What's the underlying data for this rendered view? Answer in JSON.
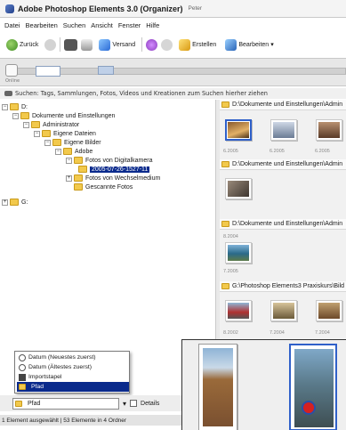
{
  "window": {
    "title": "Adobe Photoshop Elements 3.0 (Organizer)",
    "user": "Peter"
  },
  "menu": [
    "Datei",
    "Bearbeiten",
    "Suchen",
    "Ansicht",
    "Fenster",
    "Hilfe"
  ],
  "toolbar": {
    "back": "Zurück",
    "send": "Versand",
    "create": "Erstellen",
    "edit": "Bearbeiten"
  },
  "timeline": {
    "label": "Online"
  },
  "search": {
    "hint": "Suchen: Tags, Sammlungen, Fotos, Videos und Kreationen zum Suchen hierher ziehen"
  },
  "tree": [
    {
      "label": "D:"
    },
    {
      "label": "Dokumente und Einstellungen"
    },
    {
      "label": "Administrator"
    },
    {
      "label": "Eigene Dateien"
    },
    {
      "label": "Eigene Bilder"
    },
    {
      "label": "Adobe"
    },
    {
      "label": "Fotos von Digitalkamera"
    },
    {
      "label": "2005-07-26-1527-11"
    },
    {
      "label": "Fotos von Wechselmedium"
    },
    {
      "label": "Gescannte Fotos"
    },
    {
      "label": "G:"
    }
  ],
  "groups": [
    {
      "path": "D:\\Dokumente und Einstellungen\\Admin",
      "dates": [
        "6.2005",
        "6.2005",
        "6.2005"
      ]
    },
    {
      "path": "D:\\Dokumente und Einstellungen\\Admin",
      "dates": [
        "8.2004"
      ]
    },
    {
      "path": "D:\\Dokumente und Einstellungen\\Admin",
      "dates": [
        "7.2005"
      ]
    },
    {
      "path": "G:\\Photoshop Elements3 Praxiskurs\\Bild",
      "dates": [
        "8.2002",
        "7.2004",
        "7.2004"
      ]
    }
  ],
  "sort_menu": [
    {
      "label": "Datum (Neuestes zuerst)"
    },
    {
      "label": "Datum (Ältestes zuerst)"
    },
    {
      "label": "Importstapel"
    },
    {
      "label": "Pfad"
    }
  ],
  "bottom": {
    "sort_value": "Pfad",
    "details": "Details"
  },
  "status": {
    "text": "1 Element ausgewählt | 53 Elemente in 4 Ordner"
  },
  "colors": {
    "selection": "#0a2a8c",
    "thumb_selected": "#2f60c9",
    "folder": "#f2c94c"
  }
}
